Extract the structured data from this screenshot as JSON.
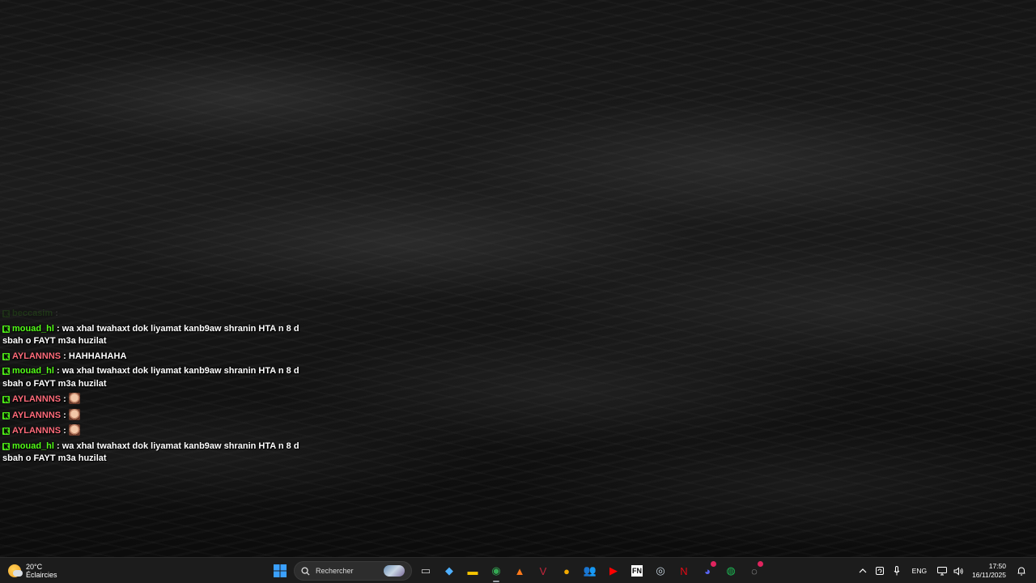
{
  "chat": {
    "messages": [
      {
        "user": "beccasim",
        "user_color": "#53fc18",
        "text": "",
        "emote": false,
        "faded": true
      },
      {
        "user": "mouad_hl",
        "user_color": "#53fc18",
        "text": "wa xhal twahaxt dok liyamat kanb9aw shranin HTA n 8 d sbah o FAYT m3a huzilat",
        "emote": false,
        "faded": false
      },
      {
        "user": "AYLANNNS",
        "user_color": "#ff6b7a",
        "text": "HAHHAHAHA",
        "emote": false,
        "faded": false
      },
      {
        "user": "mouad_hl",
        "user_color": "#53fc18",
        "text": "wa xhal twahaxt dok liyamat kanb9aw shranin HTA n 8 d sbah o FAYT m3a huzilat",
        "emote": false,
        "faded": false
      },
      {
        "user": "AYLANNNS",
        "user_color": "#ff6b7a",
        "text": "",
        "emote": true,
        "faded": false
      },
      {
        "user": "AYLANNNS",
        "user_color": "#ff6b7a",
        "text": "",
        "emote": true,
        "faded": false
      },
      {
        "user": "AYLANNNS",
        "user_color": "#ff6b7a",
        "text": "",
        "emote": true,
        "faded": false
      },
      {
        "user": "mouad_hl",
        "user_color": "#53fc18",
        "text": "wa xhal twahaxt dok liyamat kanb9aw shranin HTA n 8 d sbah o FAYT m3a huzilat",
        "emote": false,
        "faded": false
      }
    ],
    "separator": " : ",
    "badge_glyph": "K"
  },
  "taskbar": {
    "weather": {
      "temp": "20°C",
      "condition": "Éclaircies"
    },
    "search": {
      "placeholder": "Rechercher"
    },
    "apps": [
      {
        "name": "task-view",
        "glyph": "▭",
        "color": "#d0d0d0",
        "active": false
      },
      {
        "name": "copilot",
        "glyph": "◆",
        "color": "#4fb0ff",
        "active": false
      },
      {
        "name": "file-explorer",
        "glyph": "▬",
        "color": "#f5c400",
        "active": false
      },
      {
        "name": "chrome",
        "glyph": "◉",
        "color": "#34a853",
        "active": true
      },
      {
        "name": "app-orange",
        "glyph": "▲",
        "color": "#ff7a1a",
        "active": false
      },
      {
        "name": "app-v",
        "glyph": "V",
        "color": "#c4263c",
        "active": false
      },
      {
        "name": "app-badge",
        "glyph": "●",
        "color": "#f2a900",
        "active": false
      },
      {
        "name": "teams",
        "glyph": "👥",
        "color": "#6264a7",
        "active": false
      },
      {
        "name": "youtube",
        "glyph": "▶",
        "color": "#ff0000",
        "active": false
      },
      {
        "name": "fn-app",
        "glyph": "FN",
        "color": "#ffffff",
        "active": false
      },
      {
        "name": "app-steam",
        "glyph": "◎",
        "color": "#c7d5e0",
        "active": false
      },
      {
        "name": "netflix",
        "glyph": "N",
        "color": "#e50914",
        "active": false
      },
      {
        "name": "discord",
        "glyph": "◕",
        "color": "#5865f2",
        "active": false
      },
      {
        "name": "spotify",
        "glyph": "◍",
        "color": "#1db954",
        "active": false
      },
      {
        "name": "app-circle",
        "glyph": "◌",
        "color": "#d0d0d0",
        "active": false
      }
    ],
    "tray": {
      "lang": "ENG",
      "time": "17:50",
      "date": "16/11/2025"
    }
  }
}
